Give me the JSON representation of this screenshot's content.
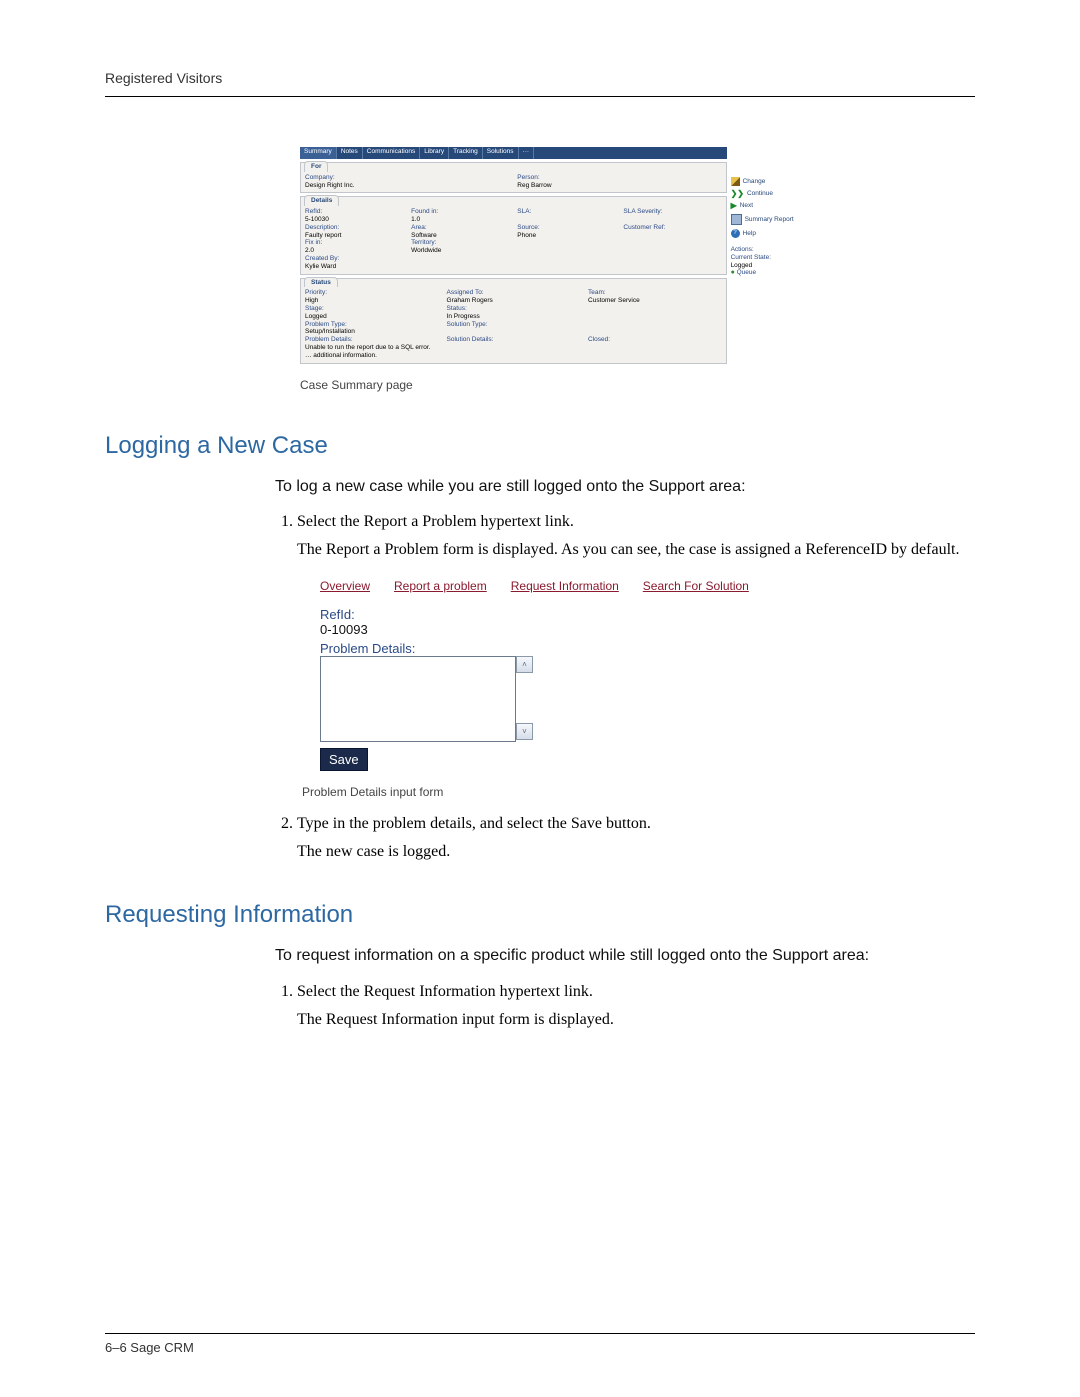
{
  "runningHead": "Registered Visitors",
  "footer": "6–6   Sage CRM",
  "heading1": "Logging a New Case",
  "intro1": "To log a new case while you are still logged onto the Support area:",
  "step1_1": "Select the Report a Problem hypertext link.",
  "step1_1b": "The Report a Problem form is displayed. As you can see, the case is assigned a ReferenceID by default.",
  "step1_2": "Type in the problem details, and select the Save button.",
  "step1_2b": "The new case is logged.",
  "caption1": "Case Summary page",
  "caption2": "Problem Details input form",
  "heading2": "Requesting Information",
  "intro2": "To request information on a specific product while still logged onto the Support area:",
  "step2_1": "Select the Request Information hypertext link.",
  "step2_1b": "The Request Information input form is displayed.",
  "tabs": {
    "t0": "Summary",
    "t1": "Notes",
    "t2": "Communications",
    "t3": "Library",
    "t4": "Tracking",
    "t5": "Solutions",
    "t6": "···"
  },
  "forPanel": {
    "title": "For",
    "companyLabel": "Company:",
    "companyValue": "Design Right Inc.",
    "personLabel": "Person:",
    "personValue": "Reg Barrow"
  },
  "detailsPanel": {
    "title": "Details",
    "refLabel": "RefId:",
    "refValue": "5-10030",
    "foundLabel": "Found in:",
    "foundValue": "1.0",
    "slaLabel": "SLA:",
    "sevLabel": "SLA Severity:",
    "descLabel": "Description:",
    "descValue": "Faulty report",
    "areaLabel": "Area:",
    "areaValue": "Software",
    "srcLabel": "Source:",
    "srcValue": "Phone",
    "custLabel": "Customer Ref:",
    "fixLabel": "Fix in:",
    "fixValue": "2.0",
    "terrLabel": "Territory:",
    "terrValue": "Worldwide",
    "byLabel": "Created By:",
    "byValue": "Kylie Ward"
  },
  "statusPanel": {
    "title": "Status",
    "priLabel": "Priority:",
    "priValue": "High",
    "asnLabel": "Assigned To:",
    "asnValue": "Graham Rogers",
    "teamLabel": "Team:",
    "teamValue": "Customer Service",
    "stgLabel": "Stage:",
    "stgValue": "Logged",
    "stLabel": "Status:",
    "stValue": "In Progress",
    "ptLabel": "Problem Type:",
    "ptValue": "Setup/Installation",
    "solLabel": "Solution Type:",
    "pdLabel": "Problem Details:",
    "pdValue": "Unable to run the report due to a SQL error. … additional information.",
    "sdLabel": "Solution Details:",
    "clLabel": "Closed:"
  },
  "rightActions": {
    "change": "Change",
    "continue": "Continue",
    "next": "Next",
    "summaryReport": "Summary Report",
    "help": "Help",
    "actionsHead": "Actions:",
    "curStateLabel": "Current State:",
    "curStateValue": "Logged",
    "queue": "Queue"
  },
  "form2": {
    "links": {
      "overview": "Overview",
      "report": "Report a problem",
      "request": "Request Information",
      "search": "Search For Solution"
    },
    "refLabel": "RefId:",
    "refValue": "0-10093",
    "pdLabel": "Problem Details:",
    "save": "Save"
  }
}
